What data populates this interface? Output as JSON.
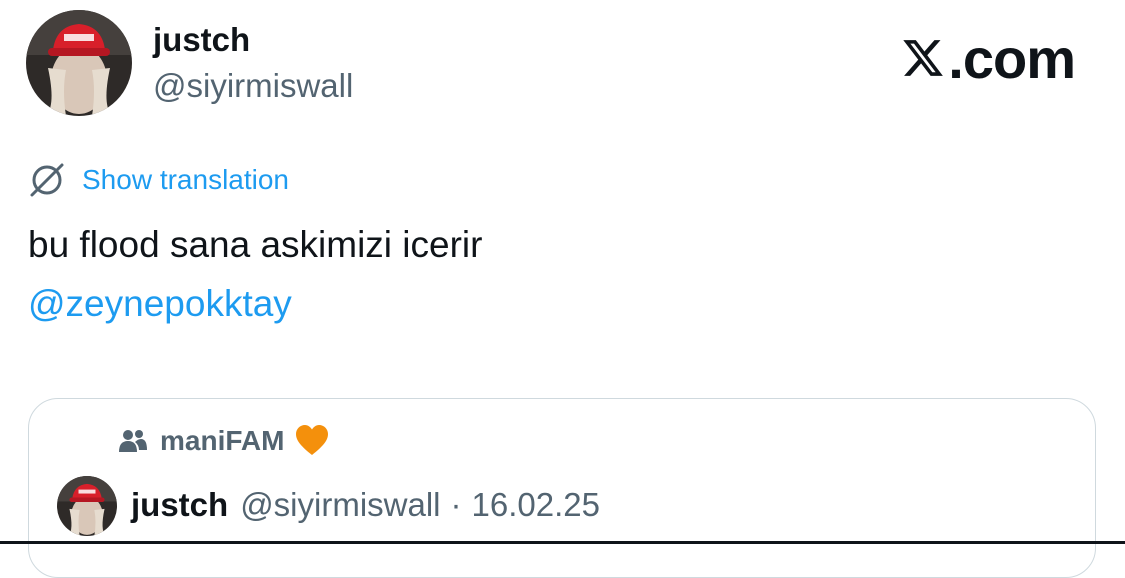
{
  "header": {
    "display_name": "justch",
    "handle": "@siyirmiswall",
    "avatar_icon": "profile-photo-red-cap",
    "brand": ".com"
  },
  "tweet": {
    "translate_icon": "globe-translate-icon",
    "translate_label": "Show translation",
    "text": "bu flood sana askimizi icerir",
    "mention": "@zeynepokktay"
  },
  "quote": {
    "community_icon": "community-icon",
    "community_name": "maniFAM",
    "community_emoji": "orange-heart-icon",
    "author_name": "justch",
    "author_handle": "@siyirmiswall",
    "separator": "·",
    "date": "16.02.25"
  },
  "colors": {
    "link": "#1d9bf0",
    "secondary": "#536471",
    "primary": "#0f1419",
    "heart": "#f4900c",
    "cap": "#d81f2a"
  }
}
